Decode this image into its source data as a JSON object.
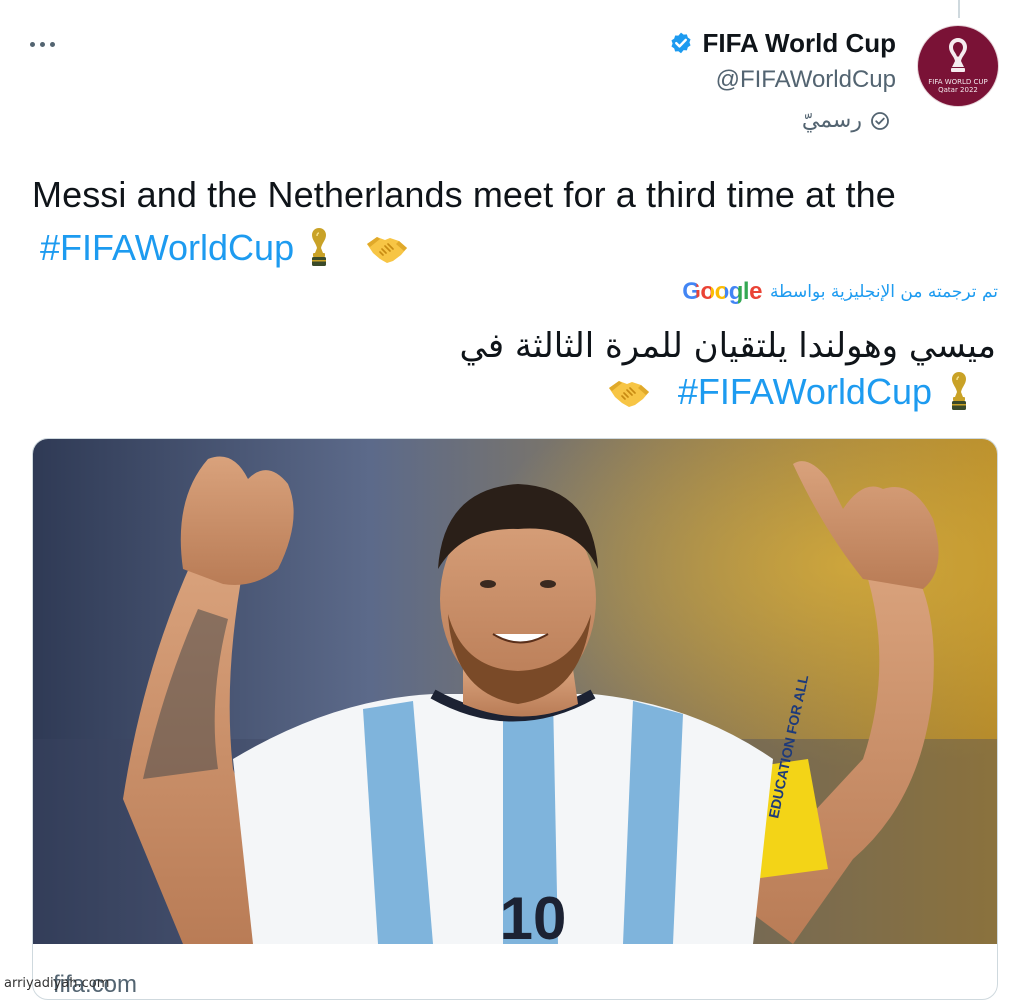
{
  "header": {
    "more_icon": "more-dots-icon",
    "display_name": "FIFA World Cup",
    "handle": "@FIFAWorldCup",
    "official_label": "رسميّ",
    "verified_icon": "verified-badge-icon",
    "avatar_text": "FIFA WORLD CUP Qatar 2022"
  },
  "tweet": {
    "text": "Messi and the Netherlands meet for a third time at the",
    "hashtag": "#FIFAWorldCup",
    "emojis": [
      "trophy-icon",
      "handshake-icon"
    ]
  },
  "translation": {
    "label": "تم ترجمته من الإنجليزية بواسطة",
    "provider": "Google",
    "text": "ميسي وهولندا يلتقيان للمرة الثالثة في",
    "hashtag": "#FIFAWorldCup"
  },
  "card": {
    "domain": "fifa.com",
    "armband_text": "EDUCATION FOR ALL",
    "shirt_number": "10"
  },
  "watermark": "arriyadiyah.com",
  "colors": {
    "link": "#1d9bf0",
    "secondary_text": "#536471",
    "primary_text": "#0f1419",
    "avatar_bg": "#7a1236"
  }
}
